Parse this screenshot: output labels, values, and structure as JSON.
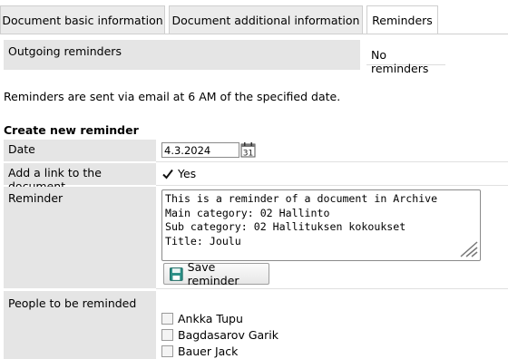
{
  "tabs": [
    {
      "label": "Document basic information"
    },
    {
      "label": "Document additional information"
    },
    {
      "label": "Reminders"
    }
  ],
  "outgoing": {
    "label": "Outgoing reminders",
    "value": "No reminders"
  },
  "info_text": "Reminders are sent via email at 6 AM of the specified date.",
  "create": {
    "title": "Create new reminder",
    "date_label": "Date",
    "date_value": "4.3.2024",
    "calendar_icon": "calendar-icon",
    "link_label": "Add a link to the document",
    "link_option": "Yes",
    "link_checked": true,
    "reminder_label": "Reminder",
    "reminder_text": "This is a reminder of a document in Archive\nMain category: 02 Hallinto\nSub category: 02 Hallituksen kokoukset\nTitle: Joulu",
    "save_label": "Save reminder",
    "save_icon": "floppy-disk-icon"
  },
  "people": {
    "label": "People to be reminded",
    "items": [
      {
        "name": "Ankka Tupu"
      },
      {
        "name": "Bagdasarov Garik"
      },
      {
        "name": "Bauer Jack"
      }
    ]
  },
  "colors": {
    "label_bg": "#e5e5e5",
    "tab_bg": "#ebebeb",
    "border": "#cfcfcf",
    "save_icon": "#2a8f86"
  }
}
